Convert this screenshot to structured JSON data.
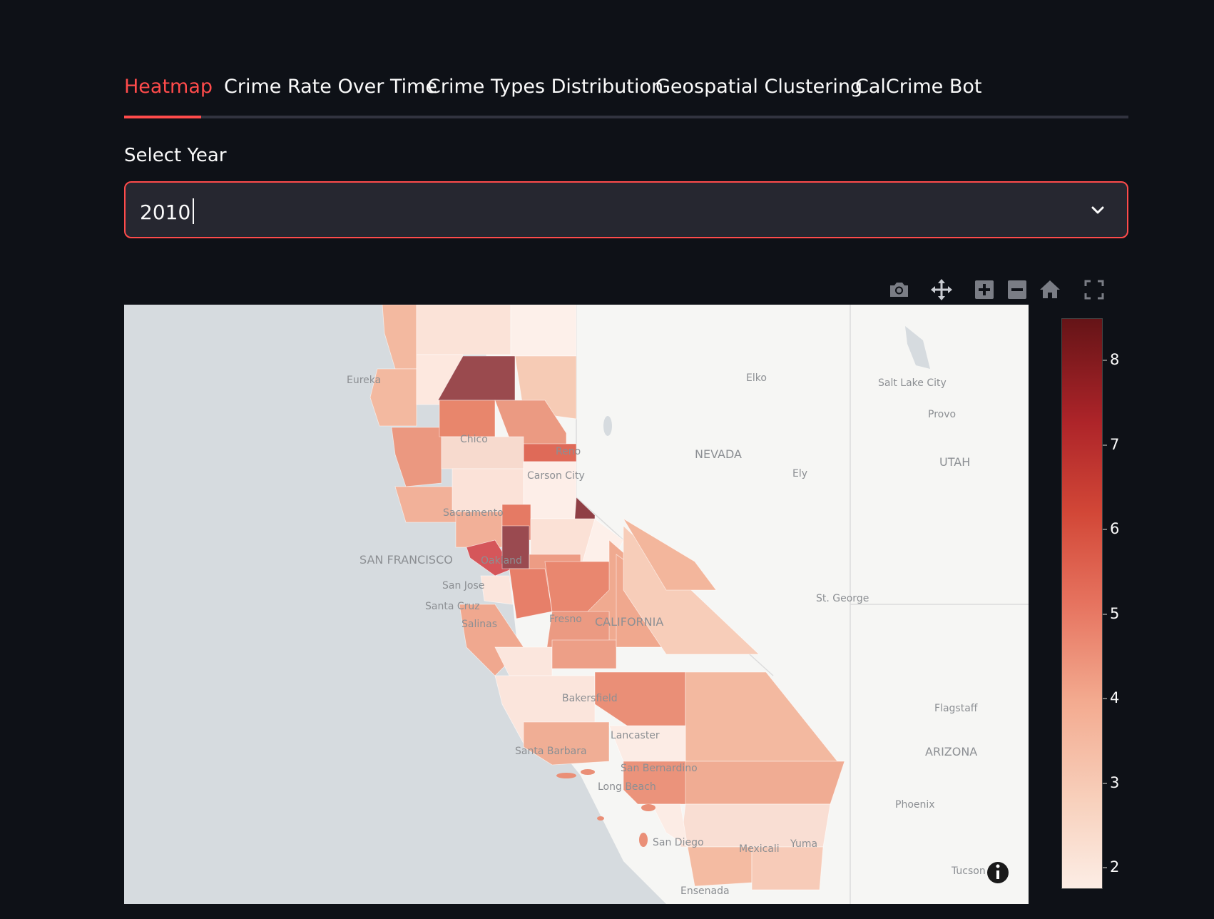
{
  "tabs": [
    {
      "label": "Heatmap",
      "active": true
    },
    {
      "label": "Crime Rate Over Time",
      "active": false
    },
    {
      "label": "Crime Types Distribution",
      "active": false
    },
    {
      "label": "Geospatial Clustering",
      "active": false
    },
    {
      "label": "CalCrime Bot",
      "active": false
    }
  ],
  "year_select": {
    "label": "Select Year",
    "value": "2010"
  },
  "toolbar": {
    "buttons": [
      "camera-icon",
      "pan-icon",
      "zoom-in-icon",
      "zoom-out-icon",
      "home-icon",
      "fullscreen-icon"
    ]
  },
  "map": {
    "place_labels": {
      "eureka": "Eureka",
      "chico": "Chico",
      "reno": "Reno",
      "carson_city": "Carson City",
      "sacramento": "Sacramento",
      "san_francisco": "SAN FRANCISCO",
      "oakland": "Oakland",
      "san_jose": "San Jose",
      "santa_cruz": "Santa Cruz",
      "salinas": "Salinas",
      "fresno": "Fresno",
      "california": "CALIFORNIA",
      "bakersfield": "Bakersfield",
      "lancaster": "Lancaster",
      "santa_barbara": "Santa Barbara",
      "san_bernardino": "San Bernardino",
      "long_beach": "Long Beach",
      "san_diego": "San Diego",
      "mexicali": "Mexicali",
      "yuma": "Yuma",
      "ensenada": "Ensenada",
      "elko": "Elko",
      "nevada": "NEVADA",
      "ely": "Ely",
      "salt_lake_city": "Salt Lake City",
      "provo": "Provo",
      "utah": "UTAH",
      "st_george": "St. George",
      "flagstaff": "Flagstaff",
      "arizona": "ARIZONA",
      "phoenix": "Phoenix",
      "tucson": "Tucson"
    },
    "info_icon": "info-icon",
    "colors": {
      "water": "#d6dbdf",
      "land": "#f6f6f4",
      "low": "#fcede5",
      "high": "#651417"
    }
  },
  "colorbar": {
    "ticks": [
      "8",
      "7",
      "6",
      "5",
      "4",
      "3",
      "2"
    ],
    "tick_values": [
      8,
      7,
      6,
      5,
      4,
      3,
      2
    ],
    "range": [
      1.75,
      8.5
    ],
    "colorscale": "Reds"
  }
}
